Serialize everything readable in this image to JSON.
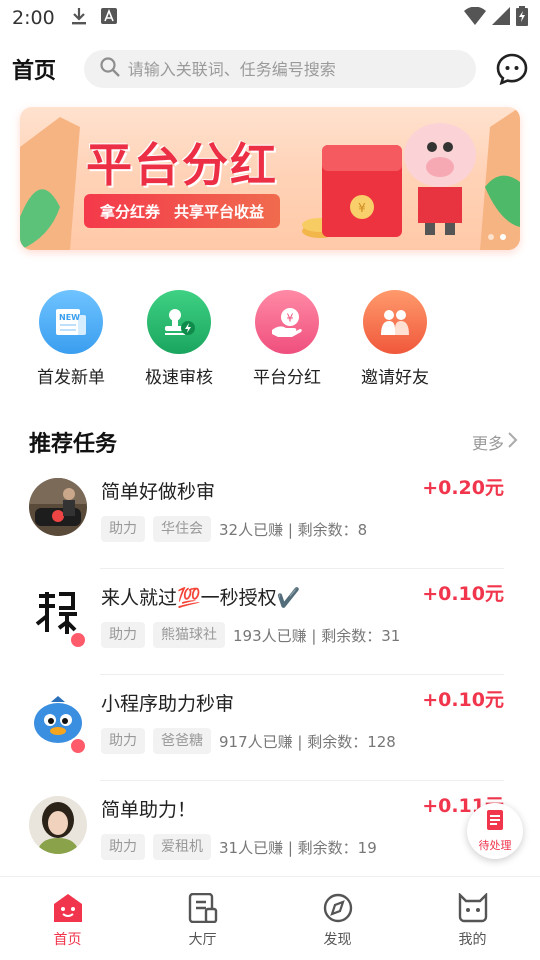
{
  "status_bar": {
    "time": "2:00"
  },
  "header": {
    "title": "首页",
    "search_placeholder": "请输入关联词、任务编号搜索"
  },
  "banner": {
    "title": "平台分红",
    "sub_left": "拿分红券",
    "sub_right": "共享平台收益"
  },
  "quick_entries": [
    {
      "label": "首发新单",
      "color": "#4aa8f0",
      "icon": "new-order-icon"
    },
    {
      "label": "极速审核",
      "color": "#23b46b",
      "icon": "fast-review-icon"
    },
    {
      "label": "平台分红",
      "color": "#f4608a",
      "icon": "dividend-icon"
    },
    {
      "label": "邀请好友",
      "color": "#f57a52",
      "icon": "invite-icon"
    }
  ],
  "section": {
    "title": "推荐任务",
    "more": "更多"
  },
  "tasks": [
    {
      "title": "简单好做秒审",
      "reward": "+0.20元",
      "tags": [
        "助力",
        "华住会"
      ],
      "stats": "32人已赚 | 剩余数：8"
    },
    {
      "title": "来人就过💯一秒授权✔️",
      "reward": "+0.10元",
      "tags": [
        "助力",
        "熊猫球社"
      ],
      "stats": "193人已赚 | 剩余数：31"
    },
    {
      "title": "小程序助力秒审",
      "reward": "+0.10元",
      "tags": [
        "助力",
        "爸爸糖"
      ],
      "stats": "917人已赚 | 剩余数：128"
    },
    {
      "title": "简单助力！",
      "reward": "+0.11元",
      "tags": [
        "助力",
        "爱租机"
      ],
      "stats": "31人已赚 | 剩余数：19"
    }
  ],
  "float_button": {
    "label": "待处理"
  },
  "bottom_nav": [
    {
      "label": "首页",
      "active": true
    },
    {
      "label": "大厅",
      "active": false
    },
    {
      "label": "发现",
      "active": false
    },
    {
      "label": "我的",
      "active": false
    }
  ],
  "colors": {
    "accent": "#f0354c",
    "muted": "#999999"
  }
}
